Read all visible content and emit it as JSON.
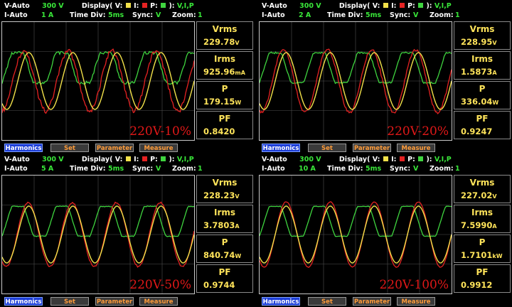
{
  "colors": {
    "voltage": "#f2e14a",
    "current": "#e52222",
    "power": "#3fd43f",
    "background": "#000000",
    "grid": "#505050"
  },
  "legend": {
    "display_label": "Display( V:",
    "i_label": "I:",
    "p_label": "P:",
    "close": "):",
    "vip": "V,I,P"
  },
  "toolbar": {
    "harmonics": "Harmonics",
    "set": "Set",
    "parameter": "Parameter",
    "measure": "Measure"
  },
  "panels": [
    {
      "v_range_label": "V-Auto",
      "v_range": "300 V",
      "i_range_label": "I-Auto",
      "i_range": "1 A",
      "time_div_label": "Time Div:",
      "time_div": "5ms",
      "sync_label": "Sync:",
      "sync": "V",
      "zoom_label": "Zoom:",
      "zoom": "1",
      "vrms_name": "Vrms",
      "vrms": "229.78",
      "vrms_unit": "V",
      "irms_name": "Irms",
      "irms": "925.96",
      "irms_unit": "mA",
      "p_name": "P",
      "p": "179.15",
      "p_unit": "W",
      "pf_name": "PF",
      "pf": "0.8420",
      "load_label": "220V-10%"
    },
    {
      "v_range_label": "V-Auto",
      "v_range": "300 V",
      "i_range_label": "I-Auto",
      "i_range": "2 A",
      "time_div_label": "Time Div:",
      "time_div": "5ms",
      "sync_label": "Sync:",
      "sync": "V",
      "zoom_label": "Zoom:",
      "zoom": "1",
      "vrms_name": "Vrms",
      "vrms": "228.95",
      "vrms_unit": "V",
      "irms_name": "Irms",
      "irms": "1.5873",
      "irms_unit": "A",
      "p_name": "P",
      "p": "336.04",
      "p_unit": "W",
      "pf_name": "PF",
      "pf": "0.9247",
      "load_label": "220V-20%"
    },
    {
      "v_range_label": "V-Auto",
      "v_range": "300 V",
      "i_range_label": "I-Auto",
      "i_range": "5 A",
      "time_div_label": "Time Div:",
      "time_div": "5ms",
      "sync_label": "Sync:",
      "sync": "V",
      "zoom_label": "Zoom:",
      "zoom": "1",
      "vrms_name": "Vrms",
      "vrms": "228.23",
      "vrms_unit": "V",
      "irms_name": "Irms",
      "irms": "3.7803",
      "irms_unit": "A",
      "p_name": "P",
      "p": "840.74",
      "p_unit": "W",
      "pf_name": "PF",
      "pf": "0.9744",
      "load_label": "220V-50%"
    },
    {
      "v_range_label": "V-Auto",
      "v_range": "300 V",
      "i_range_label": "I-Auto",
      "i_range": "10 A",
      "time_div_label": "Time Div:",
      "time_div": "5ms",
      "sync_label": "Sync:",
      "sync": "V",
      "zoom_label": "Zoom:",
      "zoom": "1",
      "vrms_name": "Vrms",
      "vrms": "227.02",
      "vrms_unit": "V",
      "irms_name": "Irms",
      "irms": "7.5990",
      "irms_unit": "A",
      "p_name": "P",
      "p": "1.7101",
      "p_unit": "kW",
      "pf_name": "PF",
      "pf": "0.9912",
      "load_label": "220V-100%"
    }
  ]
}
